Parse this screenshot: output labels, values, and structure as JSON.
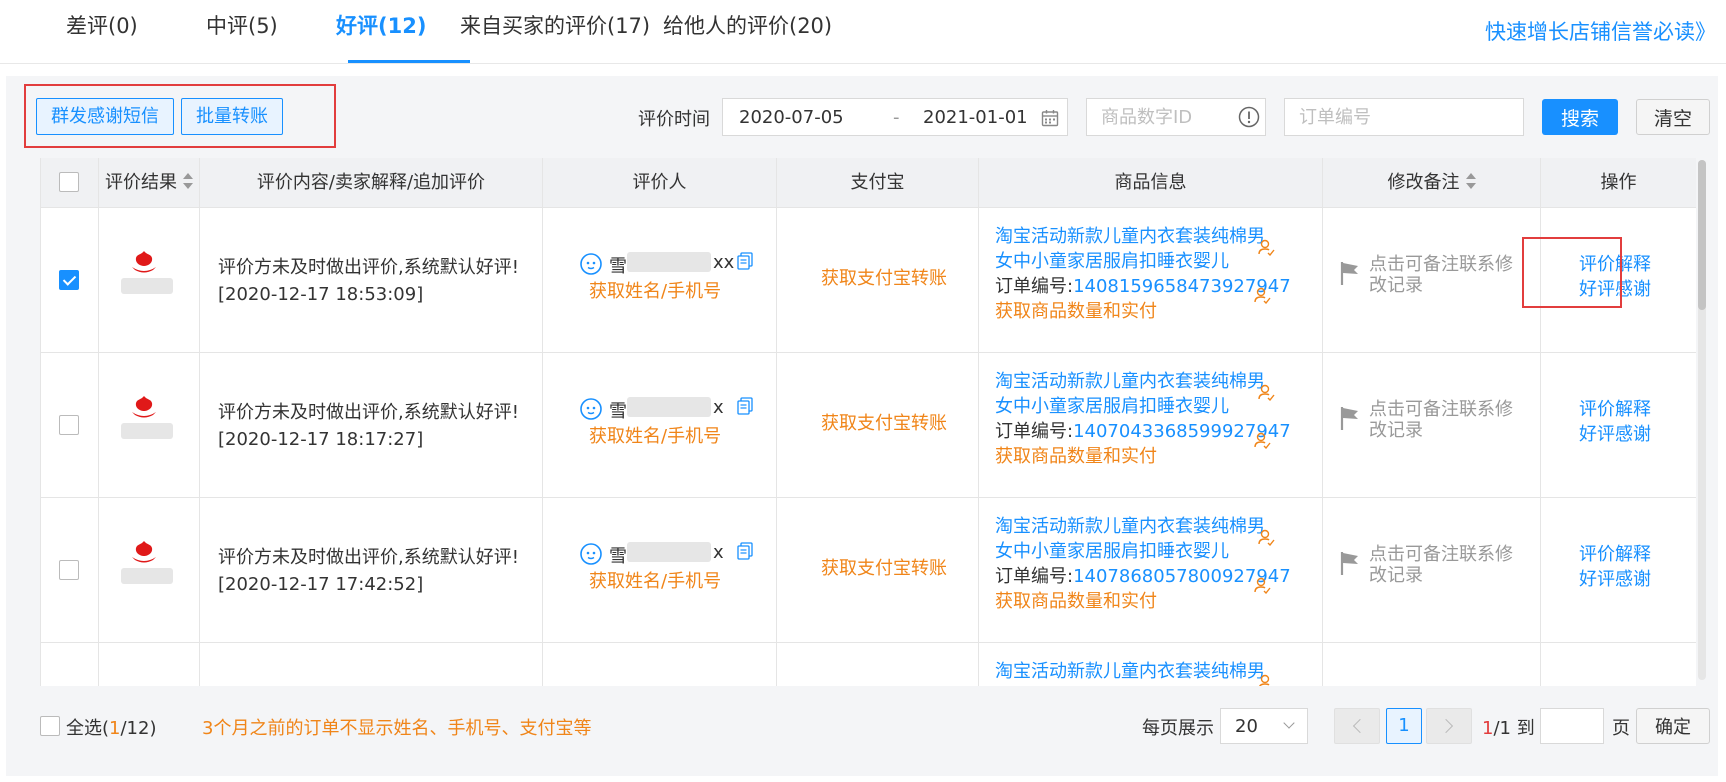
{
  "tabs": [
    {
      "label": "差评(0)"
    },
    {
      "label": "中评(5)"
    },
    {
      "label": "好评(12)",
      "active": true
    },
    {
      "label": "来自买家的评价(17)"
    },
    {
      "label": "给他人的评价(20)"
    }
  ],
  "top_link": "快速增长店铺信誉必读》",
  "toolbar": {
    "send_sms_label": "群发感谢短信",
    "batch_transfer_label": "批量转账",
    "date_label": "评价时间",
    "date_start": "2020-07-05",
    "date_sep": "-",
    "date_end": "2021-01-01",
    "goods_id_placeholder": "商品数字ID",
    "order_no_placeholder": "订单编号",
    "search_label": "搜索",
    "clear_label": "清空"
  },
  "table": {
    "columns": [
      "评价结果",
      "评价内容/卖家解释/追加评价",
      "评价人",
      "支付宝",
      "商品信息",
      "修改备注",
      "操作"
    ],
    "rows": [
      {
        "checked": true,
        "content_line1": "评价方未及时做出评价,系统默认好评!",
        "content_line2": "[2020-12-17 18:53:09]",
        "user_prefix": "雪",
        "user_suffix": "xx",
        "get_name_phone": "获取姓名/手机号",
        "alipay_action": "获取支付宝转账",
        "goods_title1": "淘宝活动新款儿童内衣套装纯棉男",
        "goods_title2": "女中小童家居服肩扣睡衣婴儿",
        "order_label": "订单编号:",
        "order_no": "1408159658473927947",
        "goods_action": "获取商品数量和实付",
        "remark1": "点击可备注联系修",
        "remark2": "改记录",
        "op1": "评价解释",
        "op2": "好评感谢"
      },
      {
        "checked": false,
        "content_line1": "评价方未及时做出评价,系统默认好评!",
        "content_line2": "[2020-12-17 18:17:27]",
        "user_prefix": "雪",
        "user_suffix": "x",
        "get_name_phone": "获取姓名/手机号",
        "alipay_action": "获取支付宝转账",
        "goods_title1": "淘宝活动新款儿童内衣套装纯棉男",
        "goods_title2": "女中小童家居服肩扣睡衣婴儿",
        "order_label": "订单编号:",
        "order_no": "1407043368599927947",
        "goods_action": "获取商品数量和实付",
        "remark1": "点击可备注联系修",
        "remark2": "改记录",
        "op1": "评价解释",
        "op2": "好评感谢"
      },
      {
        "checked": false,
        "content_line1": "评价方未及时做出评价,系统默认好评!",
        "content_line2": "[2020-12-17 17:42:52]",
        "user_prefix": "雪",
        "user_suffix": "x",
        "get_name_phone": "获取姓名/手机号",
        "alipay_action": "获取支付宝转账",
        "goods_title1": "淘宝活动新款儿童内衣套装纯棉男",
        "goods_title2": "女中小童家居服肩扣睡衣婴儿",
        "order_label": "订单编号:",
        "order_no": "1407868057800927947",
        "goods_action": "获取商品数量和实付",
        "remark1": "点击可备注联系修",
        "remark2": "改记录",
        "op1": "评价解释",
        "op2": "好评感谢"
      },
      {
        "goods_title1": "淘宝活动新款儿童内衣套装纯棉男"
      }
    ]
  },
  "footer": {
    "select_all_prefix": "全选(",
    "selected_count": "1",
    "select_all_suffix": "/12)",
    "notice": "3个月之前的订单不显示姓名、手机号、支付宝等",
    "per_page_label": "每页展示",
    "per_page_value": "20",
    "current_page": "1",
    "page_current": "1",
    "page_total_suffix": "/1 到",
    "page_unit": "页",
    "confirm_label": "确定"
  },
  "colors": {
    "accent": "#1890ff",
    "orange": "#f08519",
    "highlight_red": "#e23d3d"
  }
}
